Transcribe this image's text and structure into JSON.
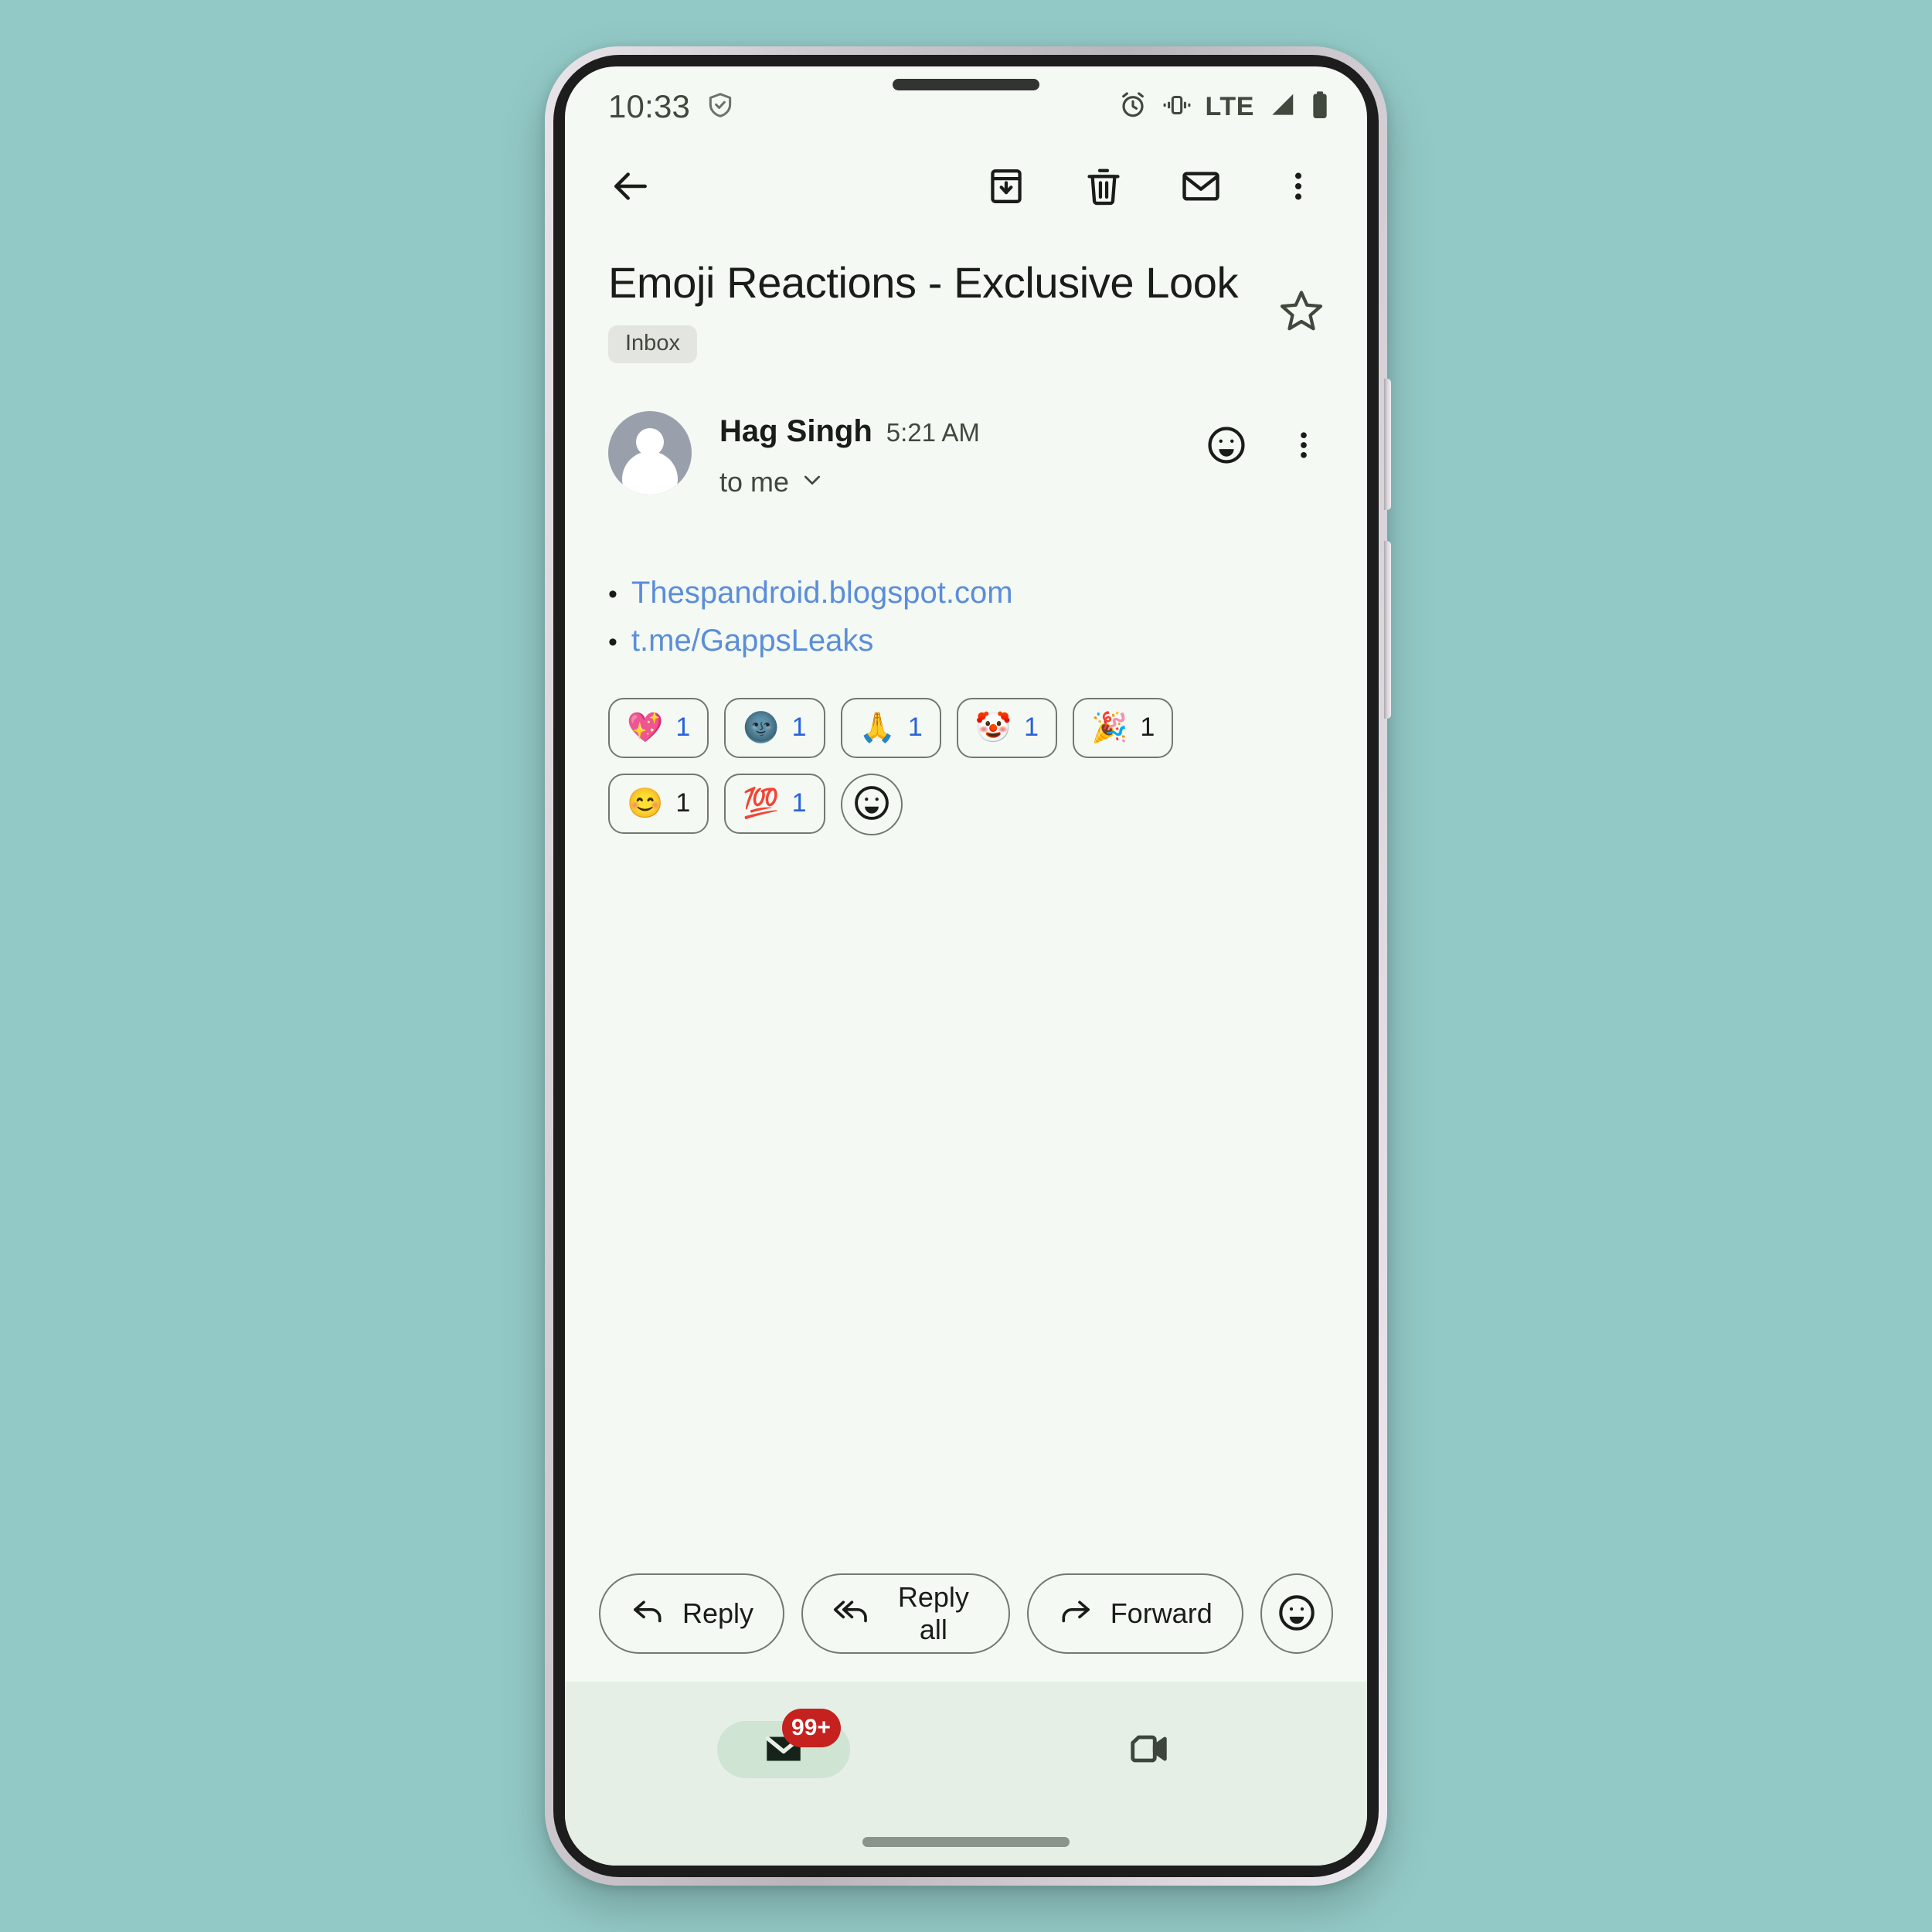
{
  "device": {
    "frame_color": "#cfcbd0",
    "screen_bg": "#f4f9f3",
    "page_bg": "#92c9c6"
  },
  "status_bar": {
    "time": "10:33",
    "shield_icon": "shield-check-icon",
    "alarm_icon": "alarm-clock-icon",
    "vibrate_icon": "vibrate-icon",
    "network_label": "LTE",
    "signal_icon": "signal-bars-icon",
    "battery_icon": "battery-full-icon"
  },
  "toolbar": {
    "back_icon": "back-arrow-icon",
    "archive_icon": "archive-icon",
    "delete_icon": "trash-icon",
    "mark_unread_icon": "envelope-icon",
    "overflow_icon": "more-vertical-icon"
  },
  "subject": {
    "title": "Emoji Reactions - Exclusive Look",
    "label": "Inbox",
    "star_icon": "star-outline-icon"
  },
  "message": {
    "sender": "Hag Singh",
    "time": "5:21 AM",
    "recipients": "to me",
    "expand_icon": "chevron-down-icon",
    "react_icon": "add-emoji-icon",
    "overflow_icon": "more-vertical-icon",
    "avatar_icon": "person-avatar-icon"
  },
  "body": {
    "bullet": "•",
    "links": [
      {
        "text": "Thespandroid.blogspot.com"
      },
      {
        "text": "t.me/GappsLeaks"
      }
    ],
    "link_color": "#5b8dd9"
  },
  "reactions": {
    "mine_count_color": "#2962d9",
    "other_count_color": "#1a1c19",
    "chips": [
      {
        "emoji": "💖",
        "name": "sparkling-heart",
        "count": "1",
        "mine": true
      },
      {
        "emoji": "🌚",
        "name": "new-moon-face",
        "count": "1",
        "mine": true
      },
      {
        "emoji": "🙏",
        "name": "folded-hands",
        "count": "1",
        "mine": true
      },
      {
        "emoji": "🤡",
        "name": "clown-face",
        "count": "1",
        "mine": true
      },
      {
        "emoji": "🎉",
        "name": "party-popper",
        "count": "1",
        "mine": false
      },
      {
        "emoji": "😊",
        "name": "smiling-face-smiling-eyes",
        "count": "1",
        "mine": false
      },
      {
        "emoji": "💯",
        "name": "hundred-points",
        "count": "1",
        "mine": true
      }
    ],
    "add_button_icon": "add-reaction-icon"
  },
  "actions": {
    "reply": {
      "label": "Reply",
      "icon": "reply-arrow-icon"
    },
    "reply_all": {
      "label": "Reply all",
      "icon": "reply-all-arrow-icon"
    },
    "forward": {
      "label": "Forward",
      "icon": "forward-arrow-icon"
    },
    "emoji": {
      "icon": "add-emoji-icon"
    }
  },
  "bottom_nav": {
    "items": [
      {
        "name": "mail-tab",
        "icon": "mail-filled-icon",
        "badge": "99+",
        "active": true
      },
      {
        "name": "meet-tab",
        "icon": "video-camera-icon",
        "badge": "",
        "active": false
      }
    ],
    "badge_color": "#c5221f",
    "active_pill_color": "#cfe4d3"
  }
}
